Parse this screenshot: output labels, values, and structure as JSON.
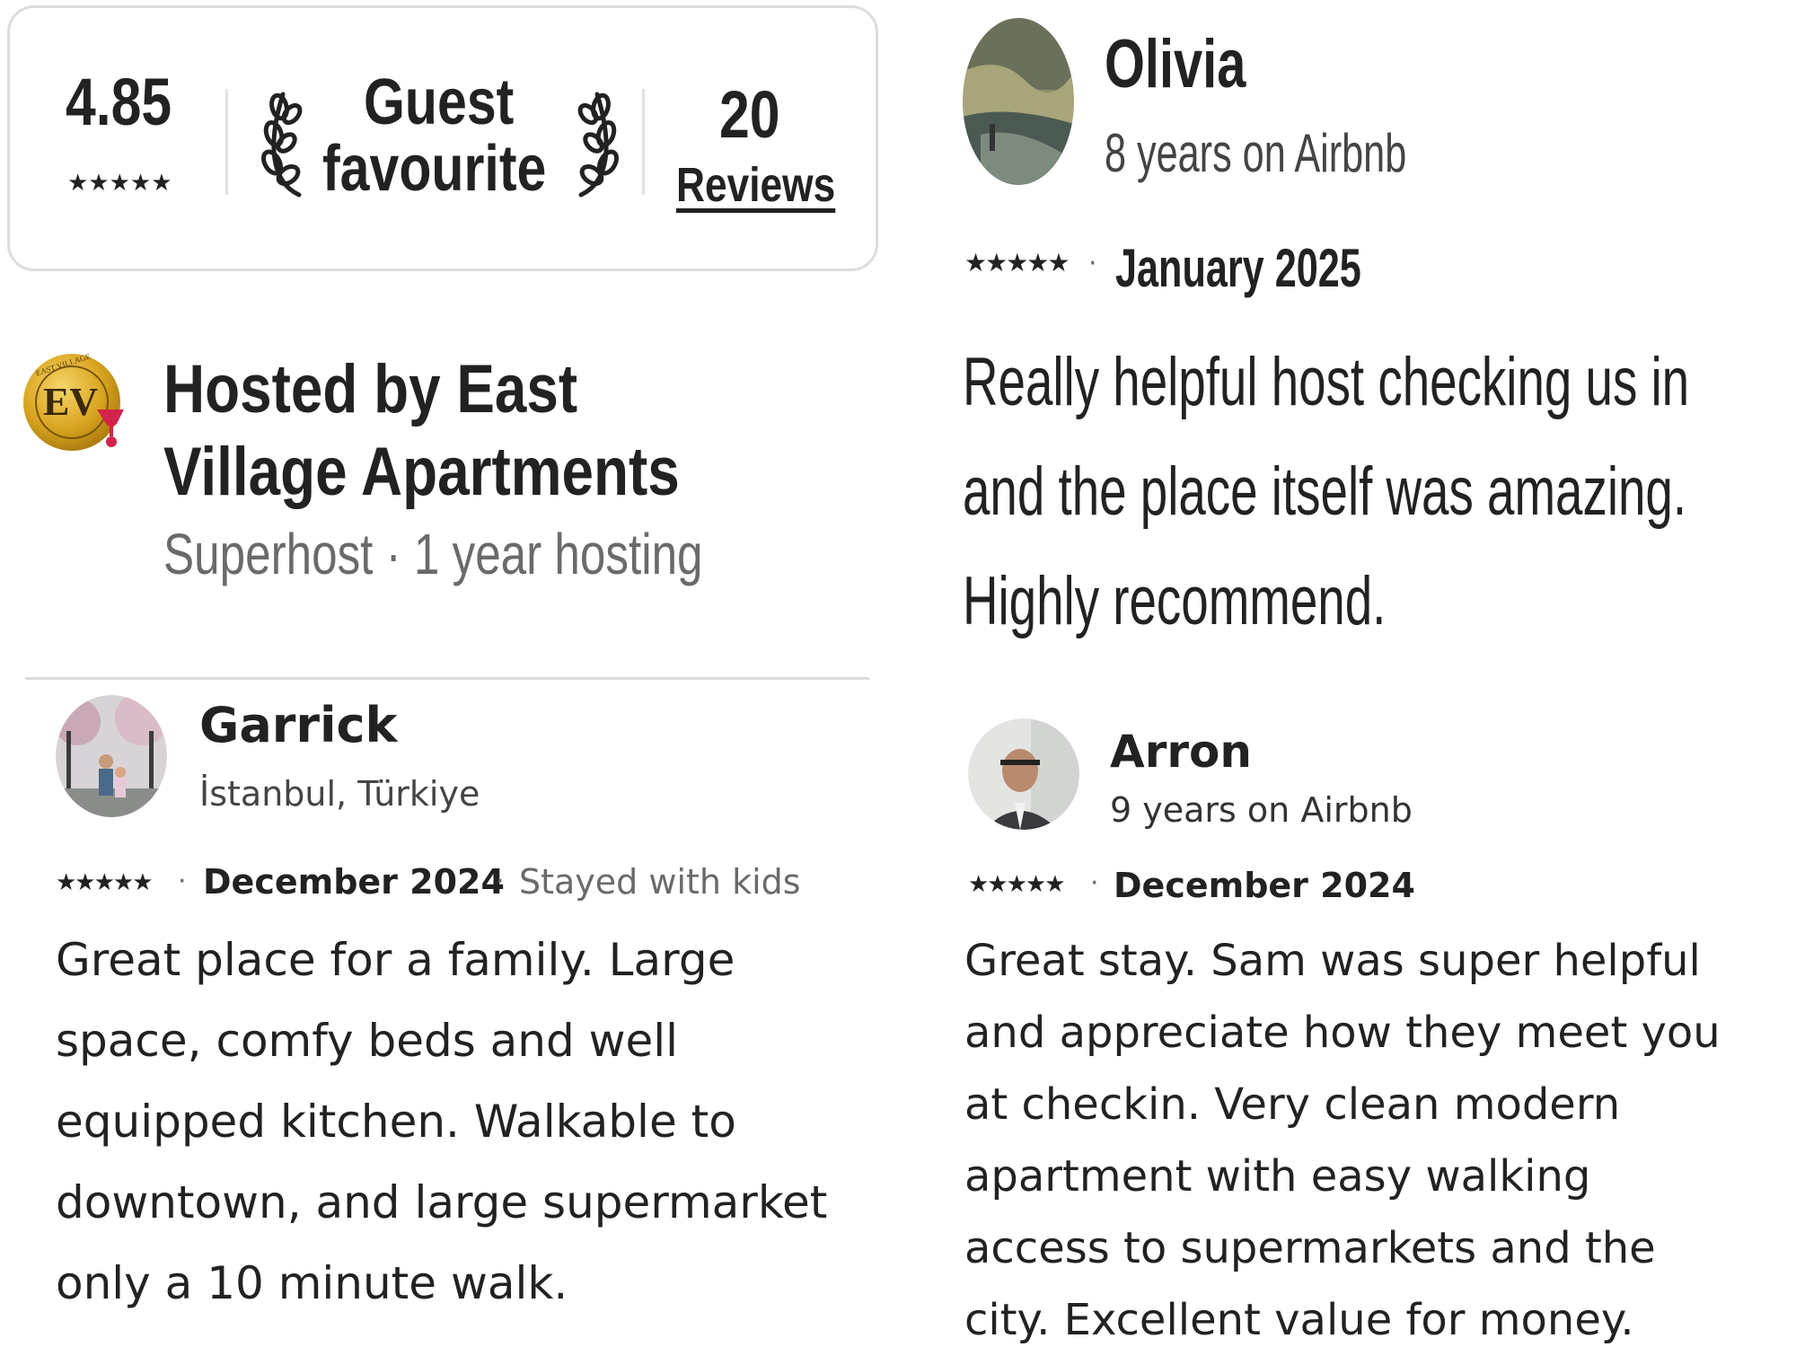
{
  "rating_card": {
    "rating": "4.85",
    "stars": "★★★★★",
    "badge_line1": "Guest",
    "badge_line2": "favourite",
    "review_count": "20",
    "reviews_link": "Reviews"
  },
  "host": {
    "logo_text": "EV",
    "logo_ring_text": "EAST VILLAGE",
    "name_line1": "Hosted by East",
    "name_line2": "Village Apartments",
    "subtitle": "Superhost · 1 year hosting"
  },
  "reviews": [
    {
      "name": "Olivia",
      "meta": "8 years on Airbnb",
      "stars": "★★★★★",
      "sep": "·",
      "date": "January 2025",
      "text_lines": [
        "Really helpful host checking us in",
        "and the place itself was amazing.",
        "Highly recommend."
      ]
    },
    {
      "name": "Garrick",
      "meta": "İstanbul, Türkiye",
      "stars": "★★★★★",
      "sep": "·",
      "date": "December 2024",
      "sep2": "·",
      "tag": "Stayed with kids",
      "text_lines": [
        "Great place for a family. Large",
        "space, comfy beds and well",
        "equipped kitchen. Walkable to",
        "downtown, and large supermarket",
        "only a 10 minute walk."
      ]
    },
    {
      "name": "Arron",
      "meta": "9 years on Airbnb",
      "stars": "★★★★★",
      "sep": "·",
      "date": "December 2024",
      "text_lines": [
        "Great stay. Sam was super helpful",
        "and appreciate how they meet you",
        "at checkin. Very clean modern",
        "apartment with easy walking",
        "access to supermarkets and the",
        "city. Excellent value for money."
      ]
    }
  ],
  "colors": {
    "text": "#222222",
    "muted": "#6a6a6a",
    "divider": "#dddddd",
    "logo_gold": "#d9a520",
    "logo_red": "#d4234a"
  },
  "icons": [
    "laurel-left-icon",
    "laurel-right-icon",
    "star-icon",
    "host-logo"
  ]
}
